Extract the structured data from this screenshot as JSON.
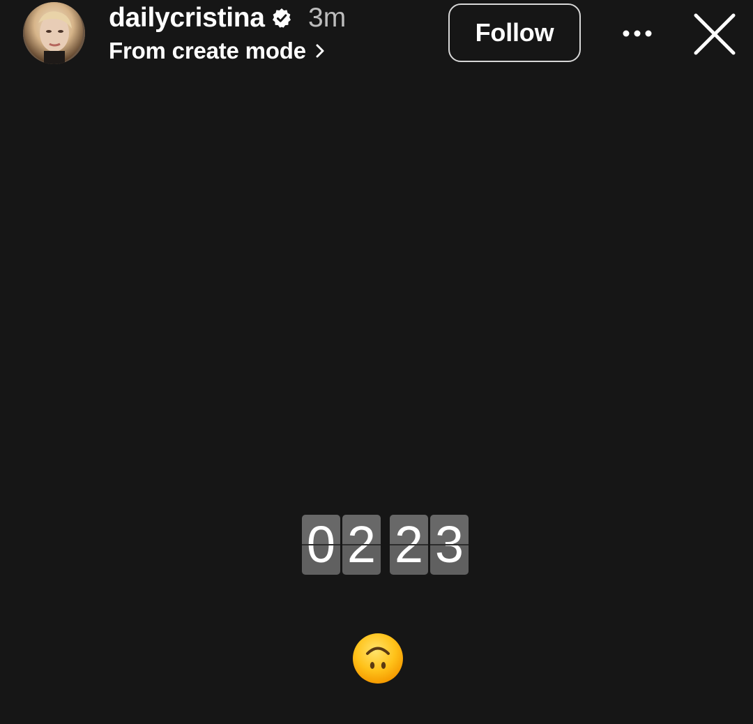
{
  "story_header": {
    "username": "dailycristina",
    "verified_icon": "verified-badge-icon",
    "time_ago": "3m",
    "subtitle": "From create mode",
    "subtitle_icon": "chevron-right-icon",
    "follow_label": "Follow",
    "more_icon": "more-options-icon",
    "close_icon": "close-icon"
  },
  "story_content": {
    "countdown_digits": [
      "0",
      "2",
      "2",
      "3"
    ],
    "emoji": "🙃",
    "emoji_icon": "upside-down-face-emoji"
  },
  "colors": {
    "background": "#161616",
    "card": "#606060",
    "text": "#ffffff",
    "muted_text": "#bdbdbd",
    "follow_border": "#d8d8d8"
  }
}
